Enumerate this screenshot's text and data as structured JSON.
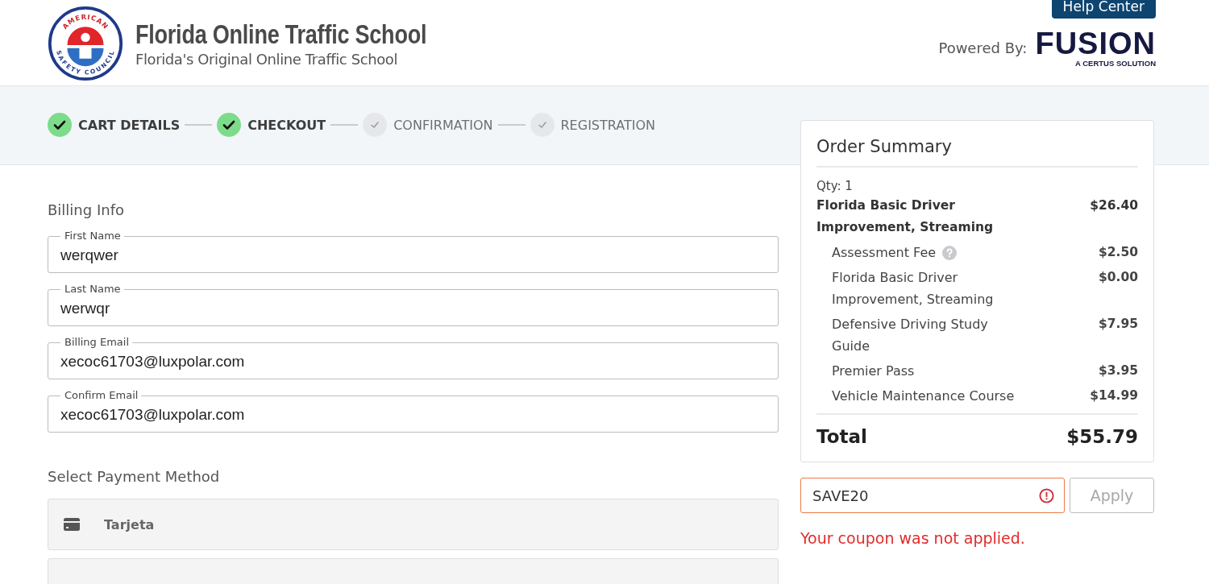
{
  "header": {
    "logo_ring_text": [
      "AMERICAN",
      "SAFETY COUNCIL"
    ],
    "title": "Florida Online Traffic School",
    "subtitle": "Florida's Original Online Traffic School",
    "help_button": "Help Center",
    "powered_by": "Powered By:",
    "partner_logo": {
      "name": "FUSION",
      "tagline": "A CERTUS SOLUTION"
    }
  },
  "steps": [
    {
      "label": "CART DETAILS",
      "done": true
    },
    {
      "label": "CHECKOUT",
      "done": true
    },
    {
      "label": "CONFIRMATION",
      "done": false
    },
    {
      "label": "REGISTRATION",
      "done": false
    }
  ],
  "billing": {
    "heading": "Billing Info",
    "fields": [
      {
        "label": "First Name",
        "value": "werqwer"
      },
      {
        "label": "Last Name",
        "value": "werwqr"
      },
      {
        "label": "Billing Email",
        "value": "xecoc61703@luxpolar.com"
      },
      {
        "label": "Confirm Email",
        "value": "xecoc61703@luxpolar.com"
      }
    ]
  },
  "payment": {
    "heading": "Select Payment Method",
    "methods": [
      {
        "label": "Tarjeta"
      }
    ]
  },
  "order_summary": {
    "title": "Order Summary",
    "qty": "Qty: 1",
    "items": [
      {
        "kind": "main",
        "name": "Florida Basic Driver Improvement, Streaming",
        "price": "$26.40"
      },
      {
        "kind": "sub",
        "name": "Assessment Fee",
        "price": "$2.50",
        "help": true
      },
      {
        "kind": "sub",
        "name": "Florida Basic Driver Improvement, Streaming",
        "price": "$0.00",
        "help": false
      },
      {
        "kind": "sub",
        "name": "Defensive Driving Study Guide",
        "price": "$7.95",
        "help": false
      },
      {
        "kind": "sub",
        "name": "Premier Pass",
        "price": "$3.95",
        "help": false
      },
      {
        "kind": "sub",
        "name": "Vehicle Maintenance Course",
        "price": "$14.99",
        "help": false
      }
    ],
    "total_label": "Total",
    "total": "$55.79"
  },
  "coupon": {
    "value": "SAVE20",
    "error": true,
    "button": "Apply",
    "message": "Your coupon was not applied."
  }
}
